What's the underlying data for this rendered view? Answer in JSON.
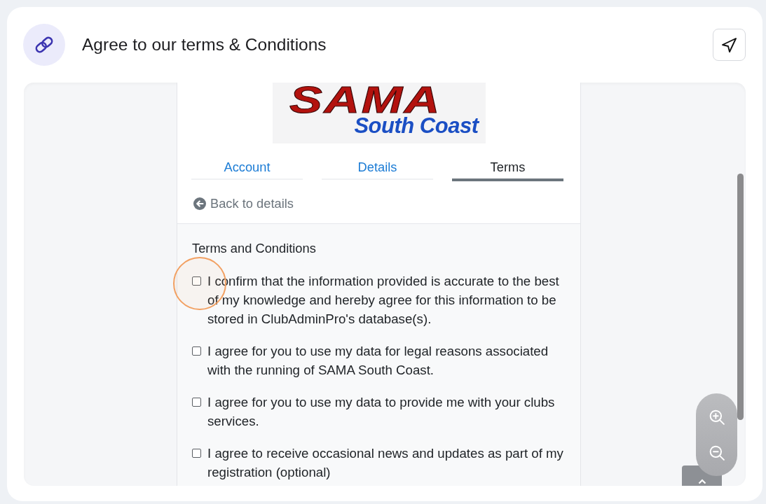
{
  "header": {
    "title": "Agree to our terms & Conditions"
  },
  "logo": {
    "line_1": "SAMA",
    "line_2": "South Coast"
  },
  "tabs": [
    {
      "label": "Account",
      "selected": false
    },
    {
      "label": "Details",
      "selected": false
    },
    {
      "label": "Terms",
      "selected": true
    }
  ],
  "back_link": {
    "label": "Back to details"
  },
  "terms": {
    "heading": "Terms and Conditions",
    "items": [
      {
        "text": "I confirm that the information provided is accurate to the best of my knowledge and hereby agree for this information to be stored in ClubAdminPro's database(s).",
        "checked": false,
        "highlighted": true
      },
      {
        "text": "I agree for you to use my data for legal reasons associated with the running of SAMA South Coast.",
        "checked": false,
        "highlighted": false
      },
      {
        "text": "I agree for you to use my data to provide me with your clubs services.",
        "checked": false,
        "highlighted": false
      },
      {
        "text": "I agree to receive occasional news and updates as part of my registration (optional)",
        "checked": false,
        "highlighted": false
      }
    ]
  }
}
